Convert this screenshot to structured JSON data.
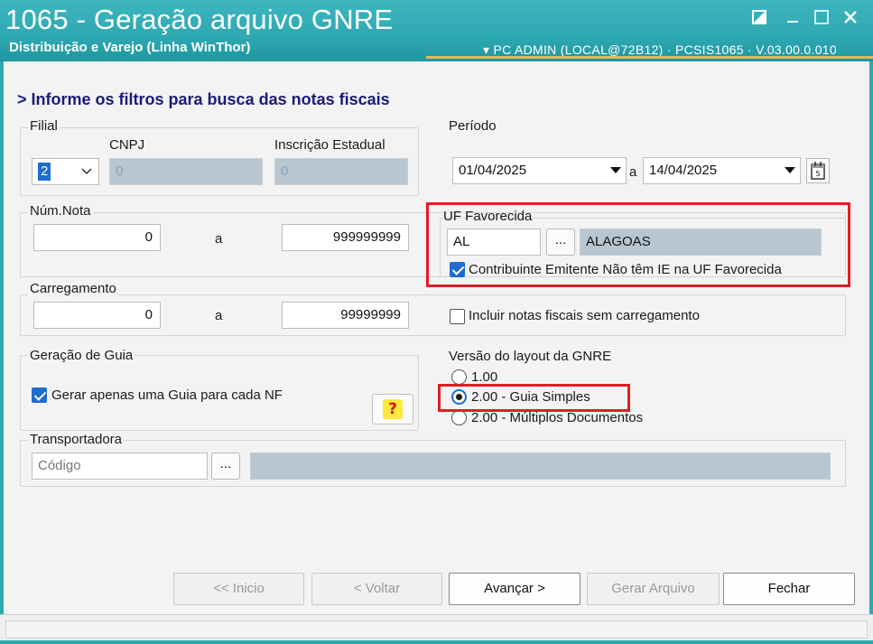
{
  "window": {
    "title": "1065 - Geração arquivo GNRE",
    "subtitle": "Distribuição e Varejo (Linha WinThor)",
    "info": "▾  PC ADMIN (LOCAL@72B12)  ·  PCSIS1065 · V.03.00.0.010"
  },
  "heading": "> Informe os filtros para busca das notas fiscais",
  "filial": {
    "group_label": "Filial",
    "value": "2",
    "cnpj_label": "CNPJ",
    "cnpj_value": "0",
    "ie_label": "Inscrição Estadual",
    "ie_value": "0"
  },
  "periodo": {
    "group_label": "Período",
    "start": "01/04/2025",
    "sep": "a",
    "end": "14/04/2025"
  },
  "num_nota": {
    "group_label": "Núm.Nota",
    "from": "0",
    "sep": "a",
    "to": "999999999"
  },
  "uf": {
    "group_label": "UF Favorecida",
    "code": "AL",
    "lookup_label": "...",
    "name": "ALAGOAS",
    "checkbox_label": "Contribuinte Emitente Não têm IE na UF Favorecida",
    "checkbox_checked": true
  },
  "carregamento": {
    "group_label": "Carregamento",
    "from": "0",
    "sep": "a",
    "to": "99999999",
    "checkbox_label": "Incluir notas fiscais sem carregamento",
    "checkbox_checked": false
  },
  "geracao": {
    "group_label": "Geração de Guia",
    "checkbox_label": "Gerar apenas uma Guia para cada NF",
    "checkbox_checked": true,
    "help_label": "?"
  },
  "versao": {
    "group_label": "Versão do layout da GNRE",
    "options": [
      "1.00",
      "2.00 - Guia Simples",
      "2.00 - Múltiplos Documentos"
    ],
    "selected": "2.00 - Guia Simples"
  },
  "transportadora": {
    "group_label": "Transportadora",
    "placeholder": "Código",
    "lookup_label": "...",
    "name": ""
  },
  "buttons": {
    "inicio": "<< Inicio",
    "voltar": "< Voltar",
    "avancar": "Avançar >",
    "gerar": "Gerar Arquivo",
    "fechar": "Fechar"
  },
  "colors": {
    "titlebar": "#2ea8b2",
    "heading": "#1b1b7a",
    "highlight": "#e01e25",
    "readonly_field": "#b8c6d1",
    "checkbox_accent": "#1f6bd0"
  }
}
